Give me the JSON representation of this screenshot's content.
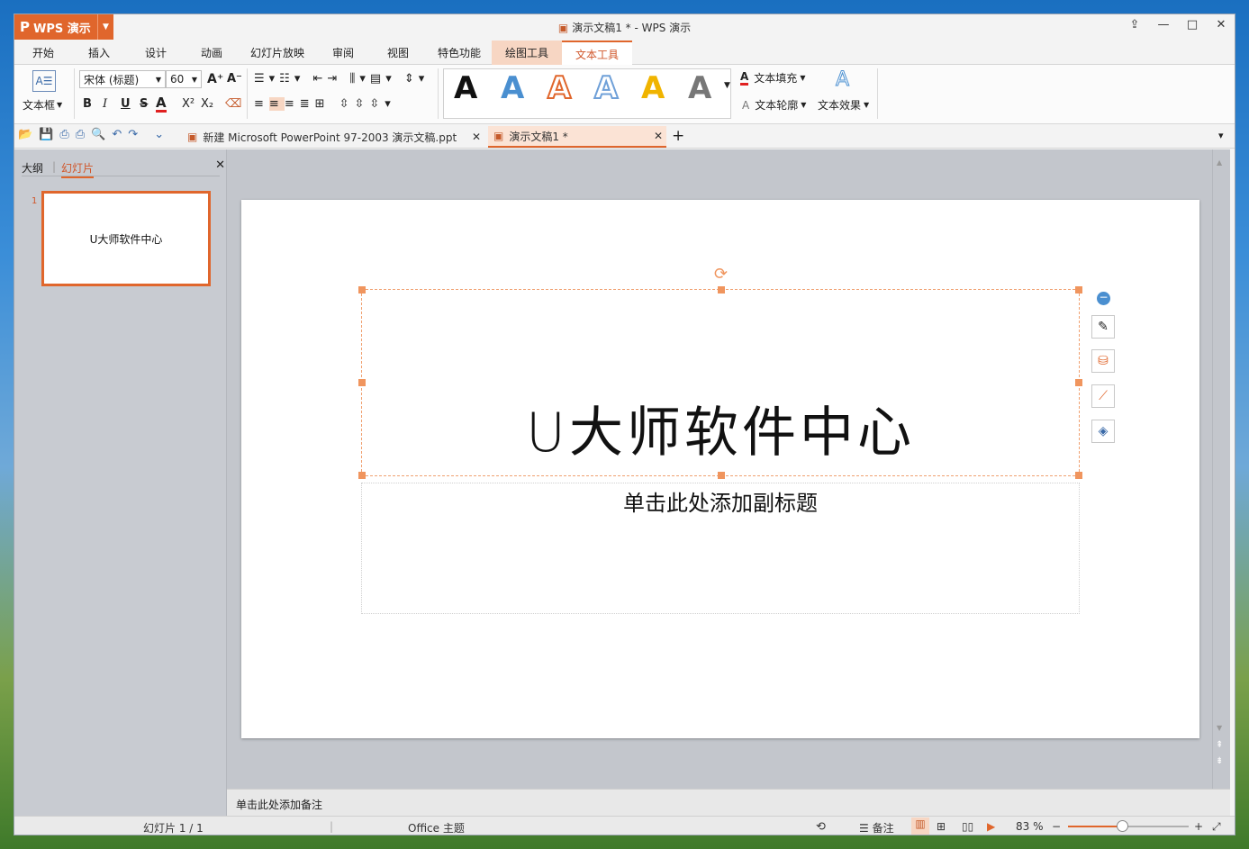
{
  "app": {
    "button_label": "WPS 演示",
    "logo": "P",
    "window_title": "演示文稿1 * - WPS 演示"
  },
  "window_controls": {
    "pin": "⇪",
    "minimize": "—",
    "maximize": "□",
    "close": "✕"
  },
  "menu": {
    "tabs": [
      "开始",
      "插入",
      "设计",
      "动画",
      "幻灯片放映",
      "审阅",
      "视图",
      "特色功能",
      "绘图工具",
      "文本工具"
    ],
    "active": "文本工具"
  },
  "ribbon": {
    "textbox_label": "文本框",
    "font_name": "宋体 (标题)",
    "font_size": "60",
    "bold": "B",
    "italic": "I",
    "underline": "U",
    "strike": "S",
    "font_color": "A",
    "superscript": "X²",
    "subscript": "X₂",
    "grow": "A⁺",
    "shrink": "A⁻",
    "style_glyph": "A",
    "text_fill": "文本填充",
    "text_outline": "文本轮廓",
    "text_effect": "文本效果",
    "style_colors": [
      "#111111",
      "#4a8fd0",
      "#e0662c",
      "#6fa0d8",
      "#f0b400",
      "#777777"
    ]
  },
  "doc_tabs": [
    {
      "name": "新建 Microsoft PowerPoint 97-2003 演示文稿.ppt"
    },
    {
      "name": "演示文稿1 *"
    }
  ],
  "left_pane": {
    "tab_outline": "大纲",
    "tab_slides": "幻灯片",
    "slide_number": "1",
    "thumb_text": "U大师软件中心"
  },
  "slide": {
    "title": "U大师软件中心",
    "subtitle": "单击此处添加副标题"
  },
  "notes": {
    "placeholder": "单击此处添加备注"
  },
  "status": {
    "slide_info": "幻灯片 1 / 1",
    "theme": "Office 主题",
    "notes_label": "备注",
    "zoom": "83 %",
    "zoom_fraction": 0.45
  }
}
